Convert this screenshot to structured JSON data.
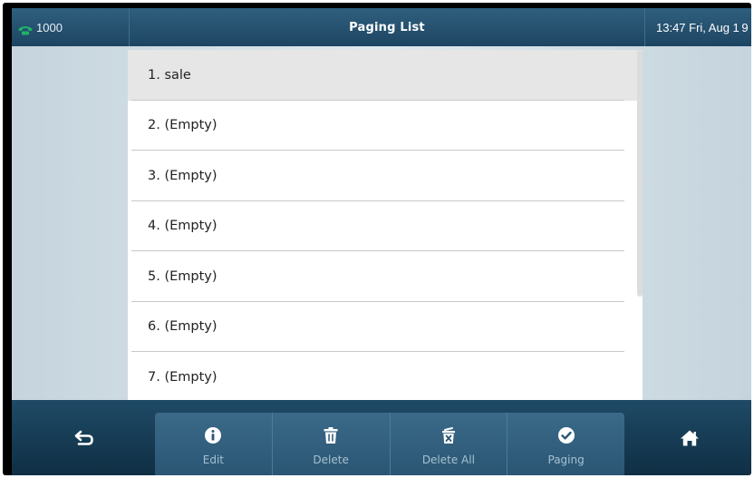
{
  "statusbar": {
    "account": "1000",
    "title": "Paging List",
    "datetime": "13:47 Fri, Aug 1 9"
  },
  "list": {
    "items": [
      {
        "label": "1. sale",
        "selected": true
      },
      {
        "label": "2. (Empty)",
        "selected": false
      },
      {
        "label": "3. (Empty)",
        "selected": false
      },
      {
        "label": "4. (Empty)",
        "selected": false
      },
      {
        "label": "5. (Empty)",
        "selected": false
      },
      {
        "label": "6. (Empty)",
        "selected": false
      },
      {
        "label": "7. (Empty)",
        "selected": false
      }
    ]
  },
  "softkeys": {
    "back_icon": "back-arrow-icon",
    "home_icon": "home-icon",
    "edit_label": "Edit",
    "edit_icon": "info-icon",
    "delete_label": "Delete",
    "delete_icon": "trash-icon",
    "delete_all_label": "Delete All",
    "delete_all_icon": "trash-x-icon",
    "paging_label": "Paging",
    "paging_icon": "check-circle-icon"
  },
  "colors": {
    "header": "#2f5f7e",
    "accent_green": "#1fb36a",
    "selected_row": "#e6e6e6",
    "softkey_bg": "#1f4a66"
  }
}
